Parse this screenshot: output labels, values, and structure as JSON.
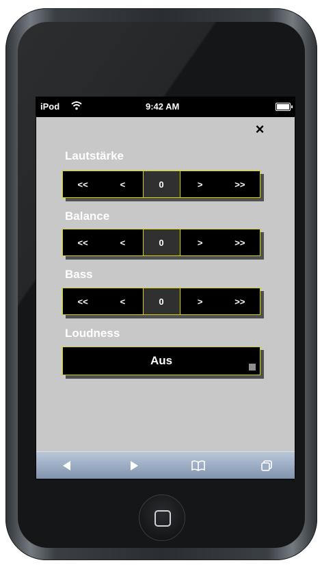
{
  "status_bar": {
    "carrier": "iPod",
    "time": "9:42 AM"
  },
  "close_label": "×",
  "controls": [
    {
      "label": "Lautstärke",
      "btn_fast_down": "<<",
      "btn_down": "<",
      "value": "0",
      "btn_up": ">",
      "btn_fast_up": ">>"
    },
    {
      "label": "Balance",
      "btn_fast_down": "<<",
      "btn_down": "<",
      "value": "0",
      "btn_up": ">",
      "btn_fast_up": ">>"
    },
    {
      "label": "Bass",
      "btn_fast_down": "<<",
      "btn_down": "<",
      "value": "0",
      "btn_up": ">",
      "btn_fast_up": ">>"
    }
  ],
  "loudness": {
    "label": "Loudness",
    "state": "Aus"
  },
  "toolbar": {
    "icons": [
      "back-icon",
      "forward-icon",
      "bookmarks-icon",
      "pages-icon"
    ]
  },
  "colors": {
    "accent_border": "#d8d400",
    "screen_bg": "#c8c8c8",
    "button_bg": "#000000",
    "value_bg": "#303030",
    "toolbar": "#9aabc3"
  }
}
